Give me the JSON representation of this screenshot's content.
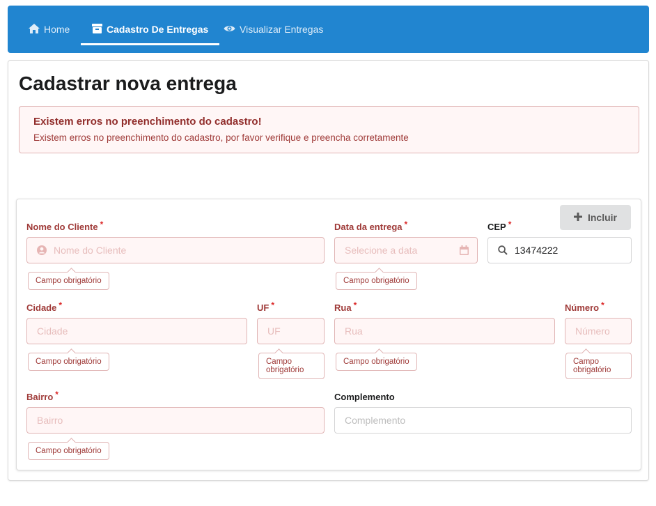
{
  "nav": {
    "home": "Home",
    "cadastro": "Cadastro De Entregas",
    "visualizar": "Visualizar Entregas"
  },
  "page": {
    "title": "Cadastrar nova entrega"
  },
  "error": {
    "header": "Existem erros no preenchimento do cadastro!",
    "message": "Existem erros no preenchimento do cadastro, por favor verifique e preencha corretamente"
  },
  "form": {
    "incluir_label": "Incluir",
    "required_mark": "*",
    "required_msg": "Campo obrigatório",
    "nome": {
      "label": "Nome do Cliente",
      "placeholder": "Nome do Cliente"
    },
    "data": {
      "label": "Data da entrega",
      "placeholder": "Selecione a data"
    },
    "cep": {
      "label": "CEP",
      "value": "13474222"
    },
    "cidade": {
      "label": "Cidade",
      "placeholder": "Cidade"
    },
    "uf": {
      "label": "UF",
      "placeholder": "UF"
    },
    "rua": {
      "label": "Rua",
      "placeholder": "Rua"
    },
    "numero": {
      "label": "Número",
      "placeholder": "Número"
    },
    "bairro": {
      "label": "Bairro",
      "placeholder": "Bairro"
    },
    "complemento": {
      "label": "Complemento",
      "placeholder": "Complemento"
    }
  },
  "icons": {
    "home": "home-icon",
    "cadastro": "box-icon",
    "visualizar": "eye-icon",
    "user": "user-icon",
    "calendar": "calendar-icon",
    "search": "search-icon",
    "plus": "plus-icon"
  },
  "colors": {
    "nav_bg": "#2185d0",
    "error_bg": "#fff6f6",
    "error_border": "#e0b4b4",
    "error_text": "#9f3a38"
  }
}
